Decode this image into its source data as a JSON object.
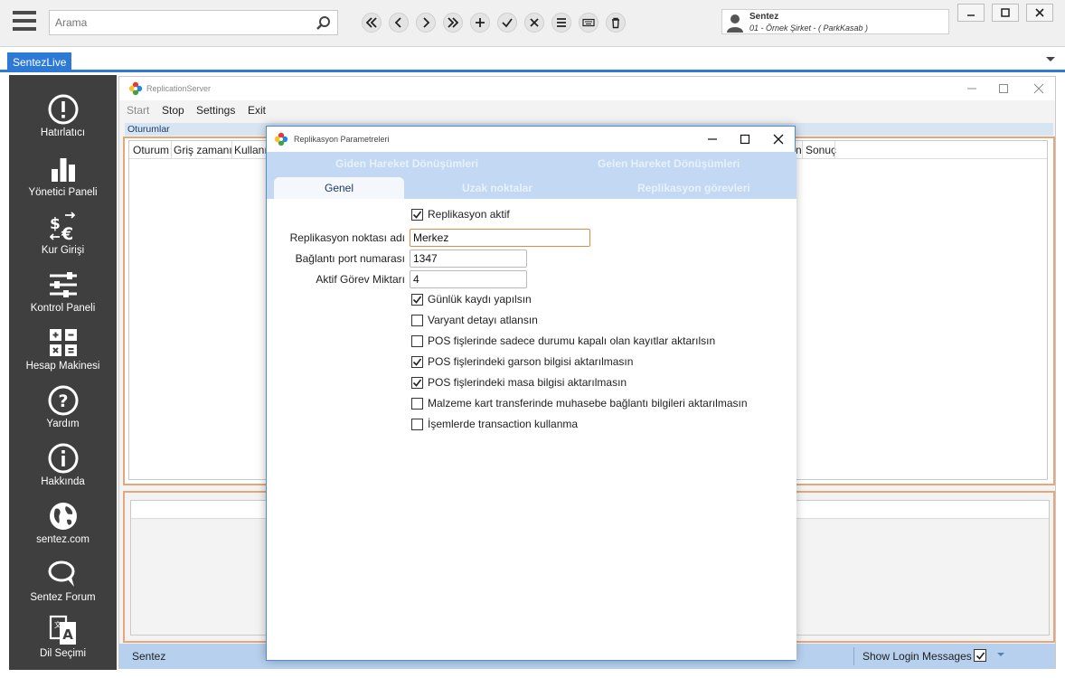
{
  "topbar": {
    "search_placeholder": "Arama",
    "nav_buttons": [
      "first",
      "previous",
      "next",
      "last",
      "add",
      "confirm",
      "cancel",
      "list",
      "keyboard",
      "delete"
    ],
    "user_name": "Sentez",
    "user_company": "01 - Örnek Şirket - ( ParkKasab )"
  },
  "tabstrip": {
    "active_tab": "SentezLive"
  },
  "sidebar": {
    "items": [
      {
        "label": "Hatırlatıcı",
        "icon": "reminder-icon"
      },
      {
        "label": "Yönetici Paneli",
        "icon": "bar-chart-icon"
      },
      {
        "label": "Kur Girişi",
        "icon": "currency-exchange-icon"
      },
      {
        "label": "Kontrol Paneli",
        "icon": "sliders-icon"
      },
      {
        "label": "Hesap Makinesi",
        "icon": "calculator-icon"
      },
      {
        "label": "Yardım",
        "icon": "help-icon"
      },
      {
        "label": "Hakkında",
        "icon": "info-icon"
      },
      {
        "label": "sentez.com",
        "icon": "globe-icon"
      },
      {
        "label": "Sentez Forum",
        "icon": "chat-icon"
      },
      {
        "label": "Dil Seçimi",
        "icon": "language-icon"
      }
    ]
  },
  "replication_window": {
    "title": "ReplicationServer",
    "menu": {
      "start": "Start",
      "stop": "Stop",
      "settings": "Settings",
      "exit": "Exit"
    },
    "sessions_label": "Oturumlar",
    "columns": {
      "c1": "Oturum",
      "c2": "Griş zamanı",
      "c3": "Kullanıc",
      "c4": "n",
      "c5": "Sonuç"
    },
    "status_left": "Sentez",
    "status_right": "Show Login Messages",
    "show_login_messages": true
  },
  "dialog": {
    "title": "Replikasyon Parametreleri",
    "tabs_row1": {
      "t1": "Giden Hareket Dönüşümleri",
      "t2": "Gelen Hareket Dönüşümleri"
    },
    "tabs_row2": {
      "t1": "Genel",
      "t2": "Uzak noktalar",
      "t3": "Replikasyon görevleri"
    },
    "active_tab": "Genel",
    "replication_active": {
      "label": "Replikasyon aktif",
      "checked": true
    },
    "fields": {
      "node_name_label": "Replikasyon noktası adı",
      "node_name_value": "Merkez",
      "port_label": "Bağlantı port numarası",
      "port_value": "1347",
      "task_count_label": "Aktif Görev Miktarı",
      "task_count_value": "4"
    },
    "options": [
      {
        "label": "Günlük kaydı yapılsın",
        "checked": true
      },
      {
        "label": "Varyant detayı atlansın",
        "checked": false
      },
      {
        "label": "POS fişlerinde sadece durumu kapalı olan kayıtlar aktarılsın",
        "checked": false
      },
      {
        "label": "POS fişlerindeki garson bilgisi aktarılmasın",
        "checked": true
      },
      {
        "label": "POS fişlerindeki masa bilgisi aktarılmasın",
        "checked": true
      },
      {
        "label": "Malzeme kart transferinde muhasebe bağlantı bilgileri aktarılmasın",
        "checked": false
      },
      {
        "label": "İşemlerde transaction kullanma",
        "checked": false
      }
    ]
  }
}
